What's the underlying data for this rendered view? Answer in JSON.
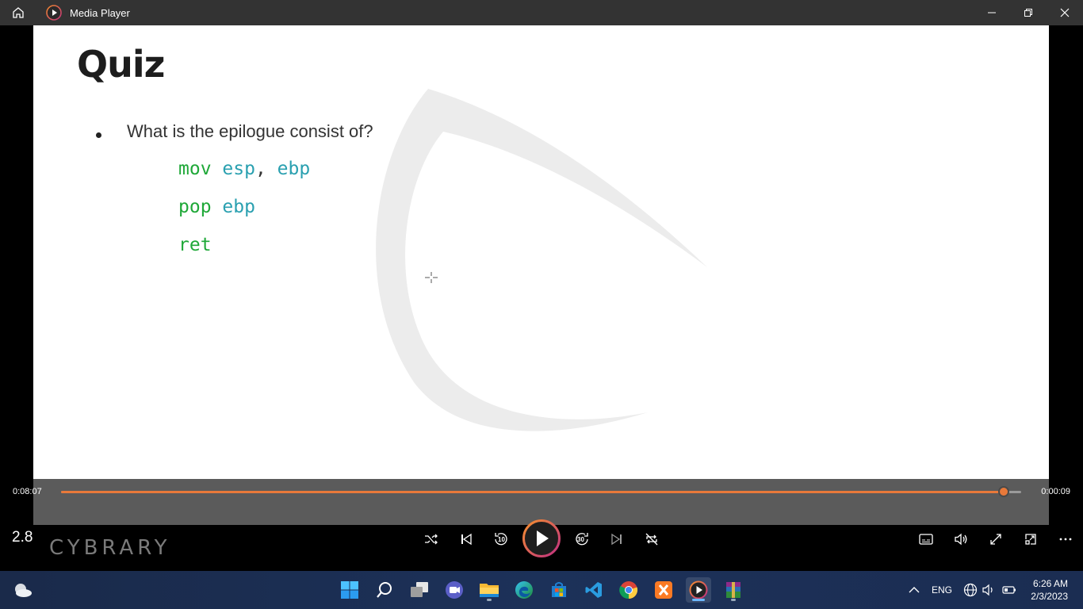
{
  "window": {
    "title": "Media Player"
  },
  "slide": {
    "title": "Quiz",
    "question": "What is the epilogue consist of?",
    "code_lines": [
      {
        "tokens": [
          {
            "t": "mov",
            "c": "kw"
          },
          {
            "t": " esp",
            "c": "reg"
          },
          {
            "t": ",",
            "c": "punc"
          },
          {
            "t": " ebp",
            "c": "reg"
          }
        ]
      },
      {
        "tokens": [
          {
            "t": "pop",
            "c": "kw"
          },
          {
            "t": " ebp",
            "c": "reg"
          }
        ]
      },
      {
        "tokens": [
          {
            "t": "ret",
            "c": "kw"
          }
        ]
      }
    ]
  },
  "player": {
    "elapsed": "0:08:07",
    "remaining": "0:00:09",
    "progress_fraction": 0.982,
    "speed": "2.8",
    "brand": "CYBRARY",
    "accent_color": "#e8793a",
    "skip_back_seconds": "10",
    "skip_forward_seconds": "30"
  },
  "taskbar": {
    "language": "ENG",
    "time": "6:26 AM",
    "date": "2/3/2023",
    "apps": [
      "start",
      "search",
      "task-view",
      "teams-chat",
      "file-explorer",
      "edge",
      "microsoft-store",
      "vscode",
      "chrome",
      "xampp",
      "media-player",
      "winrar"
    ]
  }
}
